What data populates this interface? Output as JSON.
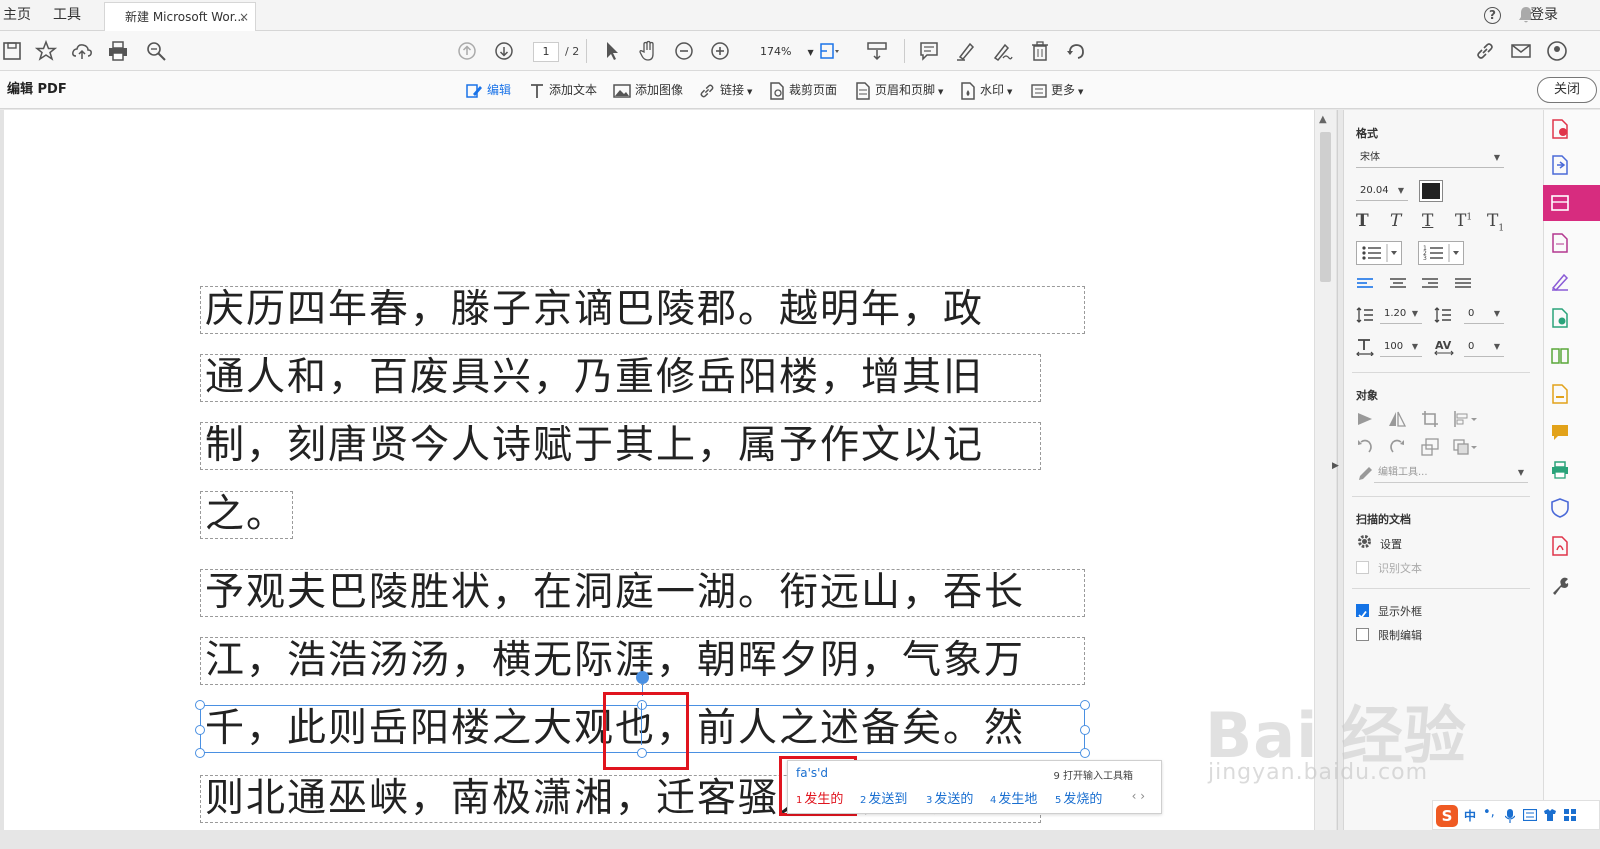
{
  "tabbar": {
    "home": "主页",
    "tools": "工具",
    "doc_tab": "新建 Microsoft Wor...",
    "close": "×",
    "login": "登录"
  },
  "toolbar": {
    "page_current": "1",
    "page_total": "/ 2",
    "zoom": "174%"
  },
  "editbar": {
    "title": "编辑 PDF",
    "items": [
      "编辑",
      "添加文本",
      "添加图像",
      "链接",
      "裁剪页面",
      "页眉和页脚",
      "水印",
      "更多"
    ],
    "close": "关闭"
  },
  "document": {
    "lines": [
      "庆历四年春，滕子京谪巴陵郡。越明年，政",
      "通人和，百废具兴，乃重修岳阳楼，增其旧",
      "制，刻唐贤今人诗赋于其上，属予作文以记",
      "之。",
      "予观夫巴陵胜状，在洞庭一湖。衔远山，吞长",
      "江，浩浩汤汤，横无际涯，朝晖夕阴，气象万",
      "千，此则岳阳楼之大观也，前人之述备矣。然",
      "则北通巫峡，南极潇湘，迁客骚人，多会于"
    ]
  },
  "ime": {
    "input": "fa's'd",
    "tool": "9 打开输入工具箱",
    "candidates": [
      {
        "num": "1",
        "text": "发生的"
      },
      {
        "num": "2",
        "text": "发送到"
      },
      {
        "num": "3",
        "text": "发送的"
      },
      {
        "num": "4",
        "text": "发生地"
      },
      {
        "num": "5",
        "text": "发烧的"
      }
    ]
  },
  "panel": {
    "format_title": "格式",
    "font": "宋体",
    "size": "20.04",
    "line_spacing": "1.20",
    "para_spacing": "0",
    "scale": "100",
    "char_spacing": "0",
    "object_title": "对象",
    "edit_tools": "编辑工具...",
    "scanned_title": "扫描的文档",
    "settings": "设置",
    "recognize": "识别文本",
    "show_bbox": "显示外框",
    "restrict": "限制编辑"
  },
  "watermark": {
    "brand": "Bai 经验",
    "url": "jingyan.baidu.com"
  },
  "imebar": {
    "logo": "S",
    "lang": "中"
  }
}
